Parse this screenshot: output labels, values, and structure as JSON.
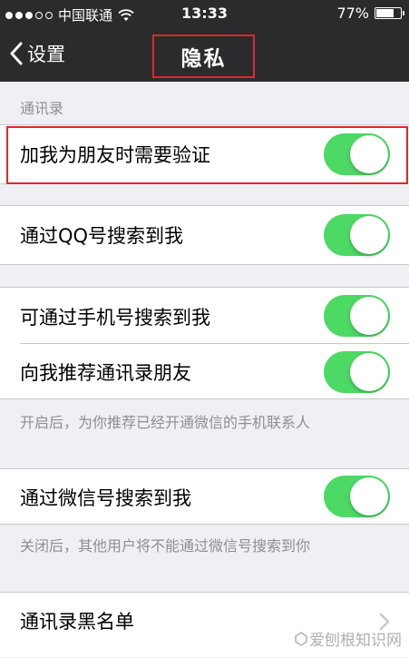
{
  "status_bar": {
    "carrier": "中国联通",
    "time": "13:33",
    "battery": "77%",
    "battery_level": 0.77,
    "signal_bars": 3,
    "signal_total": 5
  },
  "nav": {
    "back_label": "设置",
    "title": "隐私"
  },
  "sections": {
    "contacts_header": "通讯录",
    "cell1_label": "加我为朋友时需要验证",
    "cell2_label": "通过QQ号搜索到我",
    "cell3_label": "可通过手机号搜索到我",
    "cell4_label": "向我推荐通讯录朋友",
    "footer1": "开启后，为你推荐已经开通微信的手机联系人",
    "cell5_label": "通过微信号搜索到我",
    "footer2": "关闭后，其他用户将不能通过微信号搜索到你",
    "cell6_label": "通讯录黑名单"
  },
  "toggles": {
    "verify_friend": true,
    "search_by_qq": true,
    "search_by_phone": true,
    "recommend_contacts": true,
    "search_by_wechat_id": true
  },
  "colors": {
    "toggle_on": "#4cd964",
    "highlight_red": "#e0262b",
    "nav_bg": "#2b2b2d"
  },
  "watermark": "爱刨根知识网"
}
